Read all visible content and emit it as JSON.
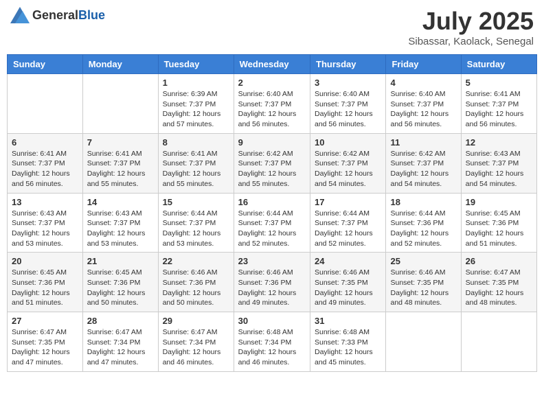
{
  "header": {
    "logo_general": "General",
    "logo_blue": "Blue",
    "month_year": "July 2025",
    "location": "Sibassar, Kaolack, Senegal"
  },
  "calendar": {
    "days_of_week": [
      "Sunday",
      "Monday",
      "Tuesday",
      "Wednesday",
      "Thursday",
      "Friday",
      "Saturday"
    ],
    "weeks": [
      [
        {
          "day": "",
          "info": ""
        },
        {
          "day": "",
          "info": ""
        },
        {
          "day": "1",
          "info": "Sunrise: 6:39 AM\nSunset: 7:37 PM\nDaylight: 12 hours and 57 minutes."
        },
        {
          "day": "2",
          "info": "Sunrise: 6:40 AM\nSunset: 7:37 PM\nDaylight: 12 hours and 56 minutes."
        },
        {
          "day": "3",
          "info": "Sunrise: 6:40 AM\nSunset: 7:37 PM\nDaylight: 12 hours and 56 minutes."
        },
        {
          "day": "4",
          "info": "Sunrise: 6:40 AM\nSunset: 7:37 PM\nDaylight: 12 hours and 56 minutes."
        },
        {
          "day": "5",
          "info": "Sunrise: 6:41 AM\nSunset: 7:37 PM\nDaylight: 12 hours and 56 minutes."
        }
      ],
      [
        {
          "day": "6",
          "info": "Sunrise: 6:41 AM\nSunset: 7:37 PM\nDaylight: 12 hours and 56 minutes."
        },
        {
          "day": "7",
          "info": "Sunrise: 6:41 AM\nSunset: 7:37 PM\nDaylight: 12 hours and 55 minutes."
        },
        {
          "day": "8",
          "info": "Sunrise: 6:41 AM\nSunset: 7:37 PM\nDaylight: 12 hours and 55 minutes."
        },
        {
          "day": "9",
          "info": "Sunrise: 6:42 AM\nSunset: 7:37 PM\nDaylight: 12 hours and 55 minutes."
        },
        {
          "day": "10",
          "info": "Sunrise: 6:42 AM\nSunset: 7:37 PM\nDaylight: 12 hours and 54 minutes."
        },
        {
          "day": "11",
          "info": "Sunrise: 6:42 AM\nSunset: 7:37 PM\nDaylight: 12 hours and 54 minutes."
        },
        {
          "day": "12",
          "info": "Sunrise: 6:43 AM\nSunset: 7:37 PM\nDaylight: 12 hours and 54 minutes."
        }
      ],
      [
        {
          "day": "13",
          "info": "Sunrise: 6:43 AM\nSunset: 7:37 PM\nDaylight: 12 hours and 53 minutes."
        },
        {
          "day": "14",
          "info": "Sunrise: 6:43 AM\nSunset: 7:37 PM\nDaylight: 12 hours and 53 minutes."
        },
        {
          "day": "15",
          "info": "Sunrise: 6:44 AM\nSunset: 7:37 PM\nDaylight: 12 hours and 53 minutes."
        },
        {
          "day": "16",
          "info": "Sunrise: 6:44 AM\nSunset: 7:37 PM\nDaylight: 12 hours and 52 minutes."
        },
        {
          "day": "17",
          "info": "Sunrise: 6:44 AM\nSunset: 7:37 PM\nDaylight: 12 hours and 52 minutes."
        },
        {
          "day": "18",
          "info": "Sunrise: 6:44 AM\nSunset: 7:36 PM\nDaylight: 12 hours and 52 minutes."
        },
        {
          "day": "19",
          "info": "Sunrise: 6:45 AM\nSunset: 7:36 PM\nDaylight: 12 hours and 51 minutes."
        }
      ],
      [
        {
          "day": "20",
          "info": "Sunrise: 6:45 AM\nSunset: 7:36 PM\nDaylight: 12 hours and 51 minutes."
        },
        {
          "day": "21",
          "info": "Sunrise: 6:45 AM\nSunset: 7:36 PM\nDaylight: 12 hours and 50 minutes."
        },
        {
          "day": "22",
          "info": "Sunrise: 6:46 AM\nSunset: 7:36 PM\nDaylight: 12 hours and 50 minutes."
        },
        {
          "day": "23",
          "info": "Sunrise: 6:46 AM\nSunset: 7:36 PM\nDaylight: 12 hours and 49 minutes."
        },
        {
          "day": "24",
          "info": "Sunrise: 6:46 AM\nSunset: 7:35 PM\nDaylight: 12 hours and 49 minutes."
        },
        {
          "day": "25",
          "info": "Sunrise: 6:46 AM\nSunset: 7:35 PM\nDaylight: 12 hours and 48 minutes."
        },
        {
          "day": "26",
          "info": "Sunrise: 6:47 AM\nSunset: 7:35 PM\nDaylight: 12 hours and 48 minutes."
        }
      ],
      [
        {
          "day": "27",
          "info": "Sunrise: 6:47 AM\nSunset: 7:35 PM\nDaylight: 12 hours and 47 minutes."
        },
        {
          "day": "28",
          "info": "Sunrise: 6:47 AM\nSunset: 7:34 PM\nDaylight: 12 hours and 47 minutes."
        },
        {
          "day": "29",
          "info": "Sunrise: 6:47 AM\nSunset: 7:34 PM\nDaylight: 12 hours and 46 minutes."
        },
        {
          "day": "30",
          "info": "Sunrise: 6:48 AM\nSunset: 7:34 PM\nDaylight: 12 hours and 46 minutes."
        },
        {
          "day": "31",
          "info": "Sunrise: 6:48 AM\nSunset: 7:33 PM\nDaylight: 12 hours and 45 minutes."
        },
        {
          "day": "",
          "info": ""
        },
        {
          "day": "",
          "info": ""
        }
      ]
    ]
  }
}
